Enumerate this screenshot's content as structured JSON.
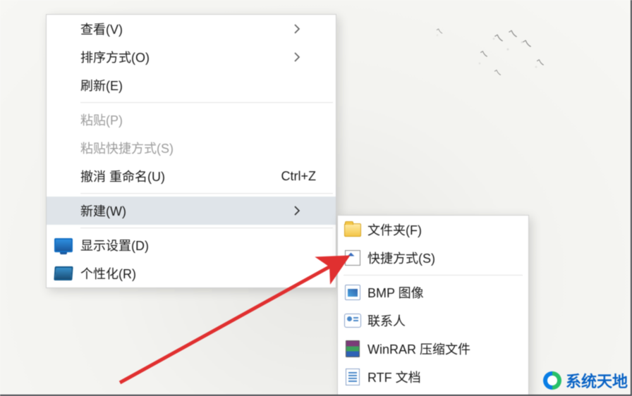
{
  "menu1": {
    "view": "查看(V)",
    "sort": "排序方式(O)",
    "refresh": "刷新(E)",
    "paste": "粘贴(P)",
    "paste_shortcut": "粘贴快捷方式(S)",
    "undo_rename": "撤消 重命名(U)",
    "undo_shortcut": "Ctrl+Z",
    "new": "新建(W)",
    "display_settings": "显示设置(D)",
    "personalize": "个性化(R)"
  },
  "menu2": {
    "folder": "文件夹(F)",
    "shortcut": "快捷方式(S)",
    "bmp": "BMP 图像",
    "contact": "联系人",
    "winrar": "WinRAR 压缩文件",
    "rtf": "RTF 文档"
  },
  "watermark": "系统天地",
  "icons": {
    "chevron": "chevron-right-icon",
    "monitor": "monitor-icon",
    "personalize": "personalize-icon",
    "folder": "folder-icon",
    "shortcut": "shortcut-icon",
    "bmp": "image-file-icon",
    "contact": "contact-card-icon",
    "rar": "archive-icon",
    "rtf": "document-icon"
  }
}
